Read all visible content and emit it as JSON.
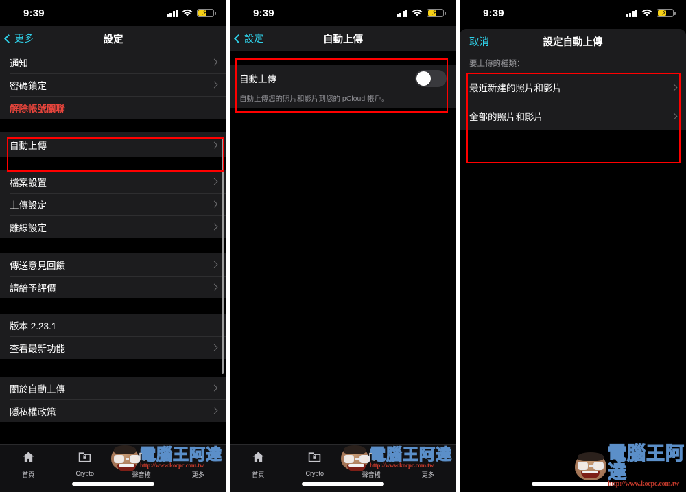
{
  "status_bar": {
    "time": "9:39",
    "signal_icon": "cellular-bars-icon",
    "wifi_icon": "wifi-icon",
    "battery_icon": "battery-charging-icon"
  },
  "watermark": {
    "brand": "電腦王阿達",
    "url": "http://www.kocpc.com.tw"
  },
  "colors": {
    "accent": "#2fd0e8",
    "danger": "#e8453c",
    "highlight": "#ff0000",
    "row_bg": "#1c1c1e",
    "page_bg": "#000000"
  },
  "panel1": {
    "nav": {
      "back_label": "更多",
      "title": "設定",
      "back_icon": "chevron-left-icon"
    },
    "groups": [
      {
        "rows": [
          {
            "label": "通知",
            "accessory": "chevron-right-icon",
            "style": "normal"
          },
          {
            "label": "密碼鎖定",
            "accessory": "chevron-right-icon",
            "style": "normal"
          },
          {
            "label": "解除帳號關聯",
            "accessory": "none",
            "style": "danger"
          }
        ]
      },
      {
        "highlighted": true,
        "rows": [
          {
            "label": "自動上傳",
            "accessory": "chevron-right-icon",
            "style": "normal"
          }
        ]
      },
      {
        "rows": [
          {
            "label": "檔案設置",
            "accessory": "chevron-right-icon",
            "style": "normal"
          },
          {
            "label": "上傳設定",
            "accessory": "chevron-right-icon",
            "style": "normal"
          },
          {
            "label": "離線設定",
            "accessory": "chevron-right-icon",
            "style": "normal"
          }
        ]
      },
      {
        "rows": [
          {
            "label": "傳送意見回饋",
            "accessory": "chevron-right-icon",
            "style": "normal"
          },
          {
            "label": "請給予評價",
            "accessory": "chevron-right-icon",
            "style": "normal"
          }
        ]
      },
      {
        "rows": [
          {
            "label": "版本 2.23.1",
            "accessory": "none",
            "style": "normal"
          },
          {
            "label": "查看最新功能",
            "accessory": "chevron-right-icon",
            "style": "normal"
          }
        ]
      },
      {
        "rows": [
          {
            "label": "關於自動上傳",
            "accessory": "chevron-right-icon",
            "style": "normal"
          },
          {
            "label": "隱私權政策",
            "accessory": "chevron-right-icon",
            "style": "normal"
          }
        ]
      }
    ],
    "tabbar": [
      {
        "label": "首頁",
        "icon": "home-icon"
      },
      {
        "label": "Crypto",
        "icon": "lock-folder-icon"
      },
      {
        "label": "聲音檔",
        "icon": "music-note-icon"
      },
      {
        "label": "更多",
        "icon": "ellipsis-icon"
      }
    ]
  },
  "panel2": {
    "nav": {
      "back_label": "設定",
      "title": "自動上傳",
      "back_icon": "chevron-left-icon"
    },
    "toggle_row": {
      "label": "自動上傳",
      "state": "off",
      "control": "switch-toggle"
    },
    "footer_note": "自動上傳您的照片和影片到您的 pCloud 帳戶。",
    "tabbar": [
      {
        "label": "首頁",
        "icon": "home-icon"
      },
      {
        "label": "Crypto",
        "icon": "lock-folder-icon"
      },
      {
        "label": "聲音檔",
        "icon": "music-note-icon"
      },
      {
        "label": "更多",
        "icon": "ellipsis-icon"
      }
    ]
  },
  "panel3": {
    "nav": {
      "cancel_label": "取消",
      "title": "設定自動上傳"
    },
    "section_header": "要上傳的種類：",
    "rows": [
      {
        "label": "最近新建的照片和影片",
        "accessory": "chevron-right-icon"
      },
      {
        "label": "全部的照片和影片",
        "accessory": "chevron-right-icon"
      }
    ]
  }
}
